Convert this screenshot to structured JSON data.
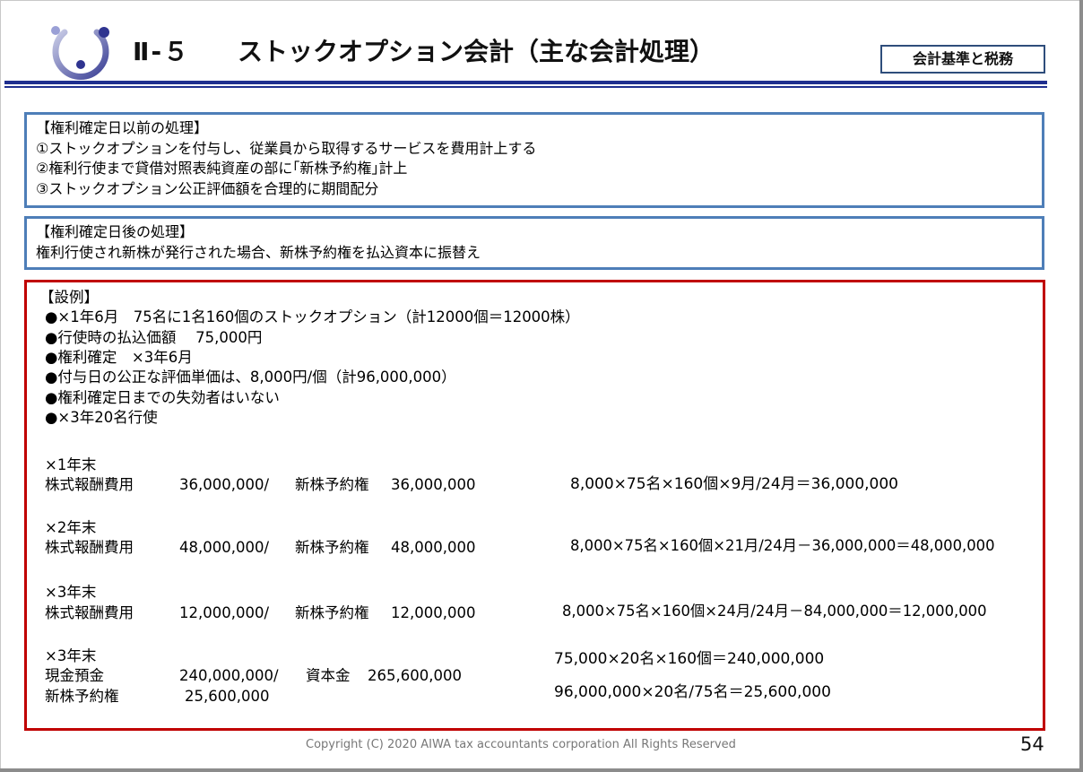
{
  "header": {
    "section_number": "Ⅱ-５",
    "title": "ストックオプション会計（主な会計処理）",
    "tag": "会計基準と税務"
  },
  "box_before": {
    "heading": "【権利確定日以前の処理】",
    "lines": [
      "①ストックオプションを付与し、従業員から取得するサービスを費用計上する",
      "②権利行使まで貸借対照表純資産の部に｢新株予約権｣計上",
      "③ストックオプション公正評価額を合理的に期間配分"
    ]
  },
  "box_after": {
    "heading": "【権利確定日後の処理】",
    "lines": [
      "権利行使され新株が発行された場合、新株予約権を払込資本に振替え"
    ]
  },
  "example": {
    "heading": "【設例】",
    "bullets": [
      "●×1年6月　75名に1名160個のストックオプション（計12000個＝12000株）",
      "●行使時の払込価額　  75,000円",
      "●権利確定　×3年6月",
      "●付与日の公正な評価単価は、8,000円/個（計96,000,000）",
      "●権利確定日までの失効者はいない",
      "●×3年20名行使"
    ],
    "entries": [
      {
        "period": "×1年末",
        "debit": "株式報酬費用",
        "debit_amount": "36,000,000/",
        "credit": "新株予約権",
        "credit_amount": "36,000,000",
        "calc": "8,000×75名×160個×9月/24月＝36,000,000"
      },
      {
        "period": "×2年末",
        "debit": "株式報酬費用",
        "debit_amount": "48,000,000/",
        "credit": "新株予約権",
        "credit_amount": "48,000,000",
        "calc": "8,000×75名×160個×21月/24月－36,000,000＝48,000,000"
      },
      {
        "period": "×3年末",
        "debit": "株式報酬費用",
        "debit_amount": "12,000,000/",
        "credit": "新株予約権",
        "credit_amount": "12,000,000",
        "calc": "8,000×75名×160個×24月/24月－84,000,000＝12,000,000"
      }
    ],
    "final": {
      "period": "×3年末",
      "debit1": "現金預金",
      "debit1_amount": "240,000,000/",
      "credit": "資本金",
      "credit_amount": "265,600,000",
      "debit2": "新株予約権",
      "debit2_amount": "25,600,000",
      "calc1": "75,000×20名×160個＝240,000,000",
      "calc2": "96,000,000×20名/75名＝25,600,000"
    }
  },
  "footer": {
    "copyright": "Copyright (C) 2020 AIWA tax accountants corporation All Rights Reserved",
    "page": "54"
  }
}
